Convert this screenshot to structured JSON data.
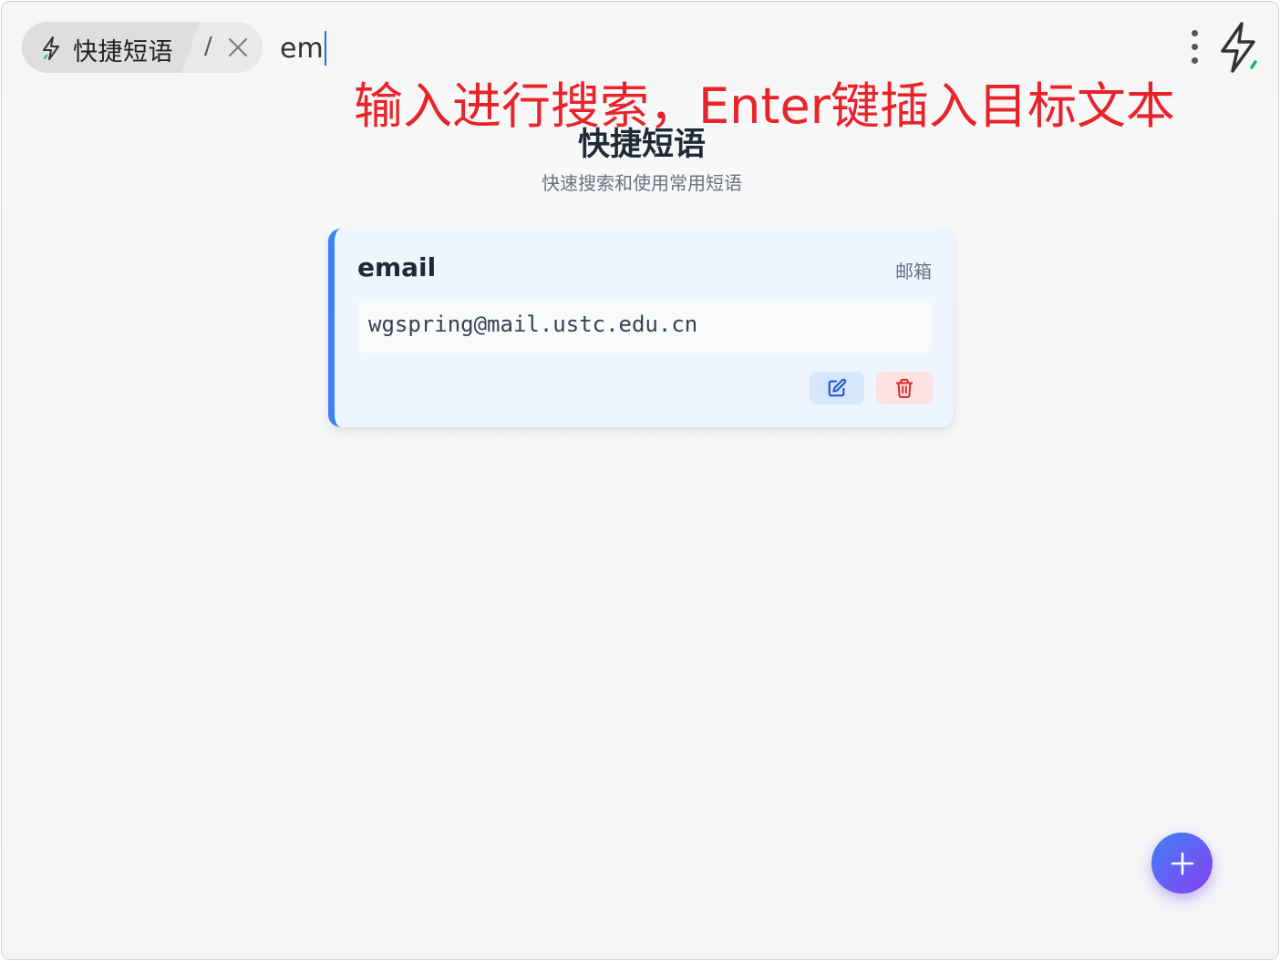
{
  "topbar": {
    "plugin_label": "快捷短语",
    "separator": "/",
    "search_value": "em"
  },
  "annotation": "输入进行搜索，Enter键插入目标文本",
  "page": {
    "title": "快捷短语",
    "subtitle": "快速搜索和使用常用短语"
  },
  "phrases": [
    {
      "title": "email",
      "tag": "邮箱",
      "content": "wgspring@mail.ustc.edu.cn"
    }
  ],
  "icons": {
    "plugin": "lightning-bolt-icon",
    "close": "close-icon",
    "menu": "more-vertical-icon",
    "app": "lightning-bolt-icon",
    "edit": "edit-icon",
    "delete": "trash-icon",
    "add": "plus-icon"
  },
  "colors": {
    "accent": "#3b82f6",
    "annotation": "#e8232a",
    "fab_start": "#3b82f6",
    "fab_end": "#8b3ef0",
    "delete": "#dc2626"
  }
}
